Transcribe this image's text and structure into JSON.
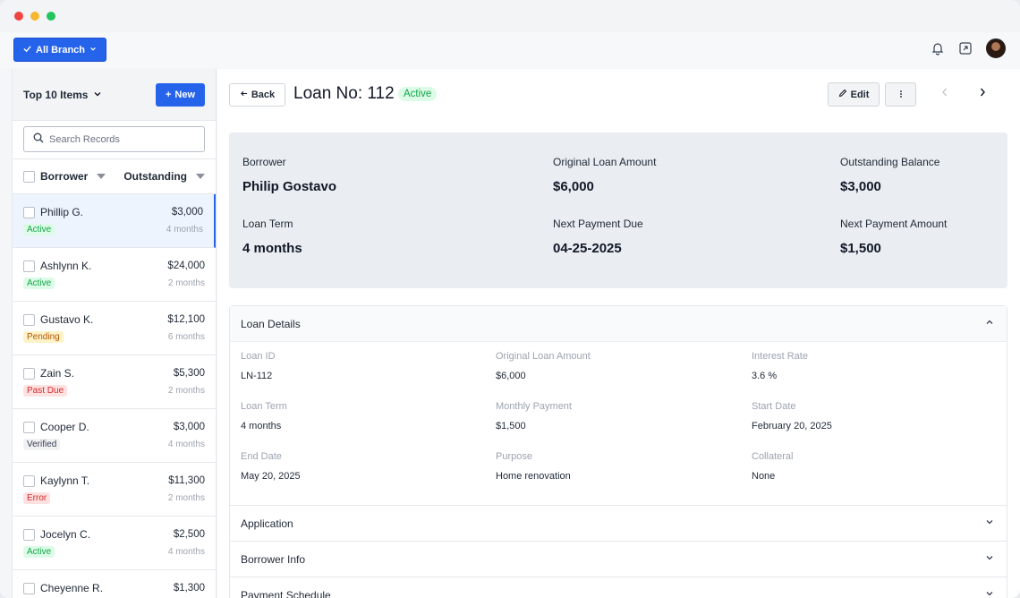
{
  "topbar": {
    "branch_label": "All Branch"
  },
  "sidebar": {
    "title": "Top 10 Items",
    "new_label": "New",
    "search_placeholder": "Search Records",
    "col_borrower": "Borrower",
    "col_outstanding": "Outstanding",
    "rows": [
      {
        "name": "Phillip G.",
        "amount": "$3,000",
        "status": "Active",
        "term": "4 months"
      },
      {
        "name": "Ashlynn K.",
        "amount": "$24,000",
        "status": "Active",
        "term": "2 months"
      },
      {
        "name": "Gustavo K.",
        "amount": "$12,100",
        "status": "Pending",
        "term": "6 months"
      },
      {
        "name": "Zain S.",
        "amount": "$5,300",
        "status": "Past Due",
        "term": "2 months"
      },
      {
        "name": "Cooper D.",
        "amount": "$3,000",
        "status": "Verified",
        "term": "4 months"
      },
      {
        "name": "Kaylynn T.",
        "amount": "$11,300",
        "status": "Error",
        "term": "2 months"
      },
      {
        "name": "Jocelyn C.",
        "amount": "$2,500",
        "status": "Active",
        "term": "4 months"
      },
      {
        "name": "Cheyenne R.",
        "amount": "$1,300",
        "status": "",
        "term": ""
      }
    ]
  },
  "main": {
    "back_label": "Back",
    "title": "Loan No: 112",
    "status": "Active",
    "edit_label": "Edit",
    "summary": {
      "borrower_label": "Borrower",
      "borrower_value": "Philip Gostavo",
      "original_label": "Original Loan Amount",
      "original_value": "$6,000",
      "outstanding_label": "Outstanding Balance",
      "outstanding_value": "$3,000",
      "term_label": "Loan Term",
      "term_value": "4 months",
      "next_due_label": "Next Payment Due",
      "next_due_value": "04-25-2025",
      "next_amt_label": "Next Payment Amount",
      "next_amt_value": "$1,500"
    },
    "details": {
      "header": "Loan Details",
      "loan_id_label": "Loan ID",
      "loan_id_value": "LN-112",
      "orig_label": "Original Loan Amount",
      "orig_value": "$6,000",
      "rate_label": "Interest Rate",
      "rate_value": "3.6 %",
      "term_label": "Loan Term",
      "term_value": "4 months",
      "monthly_label": "Monthly Payment",
      "monthly_value": "$1,500",
      "start_label": "Start Date",
      "start_value": "February 20, 2025",
      "end_label": "End Date",
      "end_value": "May 20, 2025",
      "purpose_label": "Purpose",
      "purpose_value": "Home renovation",
      "collateral_label": "Collateral",
      "collateral_value": "None"
    },
    "sections": [
      "Application",
      "Borrower Info",
      "Payment Schedule"
    ]
  },
  "colors": {
    "accent": "#2563eb",
    "active": "#16a34a",
    "pending": "#b45309",
    "error": "#dc2626"
  }
}
